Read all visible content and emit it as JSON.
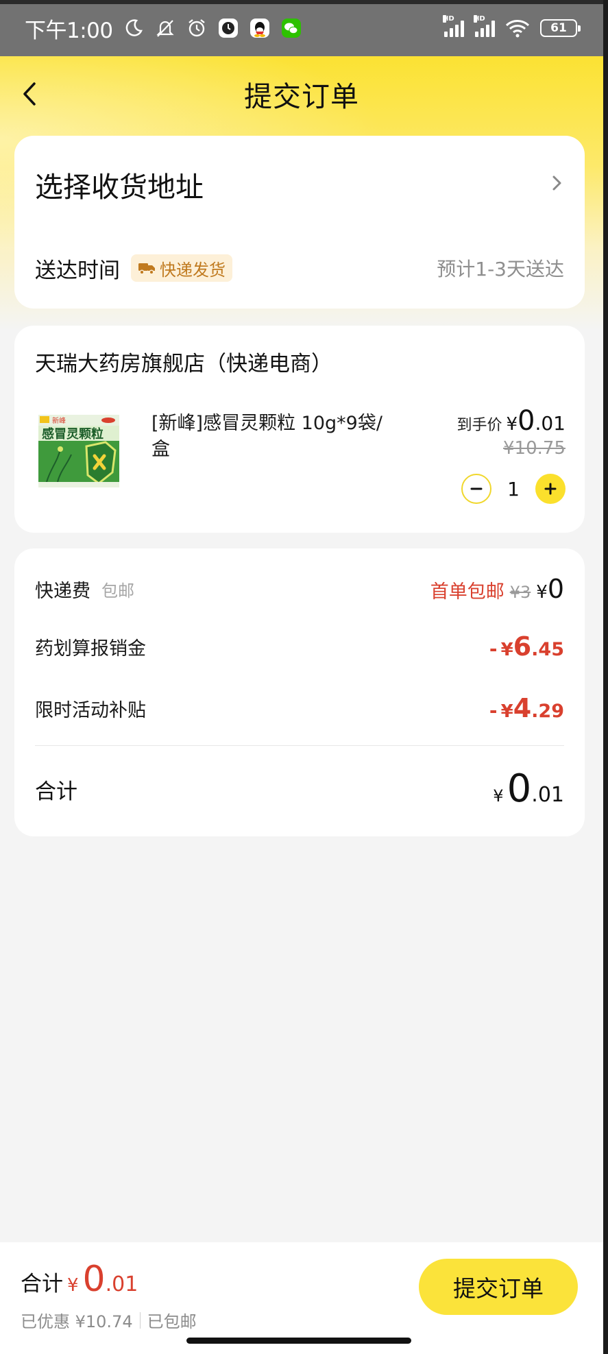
{
  "status_bar": {
    "time": "下午1:00",
    "battery": "61",
    "signal_1_label": "HD",
    "signal_2_label": "HD"
  },
  "header": {
    "title": "提交订单"
  },
  "address": {
    "placeholder": "选择收货地址",
    "delivery_label": "送达时间",
    "delivery_tag": "快递发货",
    "delivery_eta": "预计1-3天送达"
  },
  "shop": {
    "name": "天瑞大药房旗舰店（快递电商）",
    "product": {
      "title": "[新峰]感冒灵颗粒 10g*9袋/盒",
      "image_brand": "新峰",
      "image_name": "感冒灵颗粒",
      "final_label": "到手价",
      "final_yen": "¥",
      "final_int": "0",
      "final_dec": ".01",
      "original_price": "¥10.75",
      "quantity": "1"
    }
  },
  "summary": {
    "shipping_label": "快递费",
    "shipping_sub": "包邮",
    "shipping_promo": "首单包邮",
    "shipping_original": "¥3",
    "shipping_yen": "¥",
    "shipping_value": "0",
    "reimburse_label": "药划算报销金",
    "reimburse_minus": "-",
    "reimburse_yen": "¥",
    "reimburse_int": "6",
    "reimburse_dec": ".45",
    "subsidy_label": "限时活动补贴",
    "subsidy_minus": "-",
    "subsidy_yen": "¥",
    "subsidy_int": "4",
    "subsidy_dec": ".29",
    "total_label": "合计",
    "total_yen": "¥",
    "total_int": "0",
    "total_dec": ".01"
  },
  "bottom_bar": {
    "total_label": "合计",
    "total_yen": "¥",
    "total_int": "0",
    "total_dec": ".01",
    "discount_text": "已优惠 ¥10.74",
    "free_ship_text": "已包邮",
    "submit_label": "提交订单"
  },
  "colors": {
    "accent_yellow": "#fbe33a",
    "price_red": "#d9402e",
    "tag_bg": "#fdf0d8",
    "tag_text": "#c07a1f"
  }
}
